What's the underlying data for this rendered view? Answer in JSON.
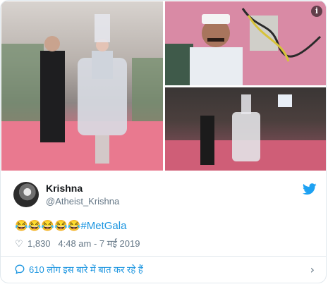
{
  "tweet": {
    "author_name": "Krishna",
    "author_handle": "@Atheist_Krishna",
    "emojis": "😂😂😂😂😂",
    "hashtag": "#MetGala",
    "likes": "1,830",
    "timestamp": "4:48 am - 7 मई 2019",
    "conversation_link": "610 लोग इस बारे में बात कर रहे हैं",
    "info_icon": "i"
  },
  "icons": {
    "twitter": "twitter-bird-icon",
    "heart": "heart-icon",
    "bubble": "speech-bubble-icon",
    "chevron": "chevron-right-icon",
    "info": "info-icon"
  },
  "colors": {
    "link": "#1b95e0",
    "secondary_text": "#657786",
    "border": "#e1e8ed"
  }
}
